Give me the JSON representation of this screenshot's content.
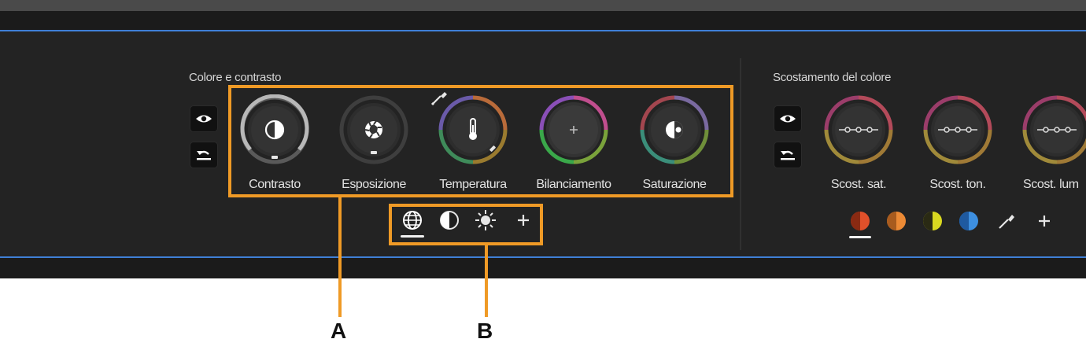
{
  "colors": {
    "accent": "#3f7fd6",
    "highlight": "#ef9a26",
    "panel_bg": "#232323"
  },
  "left_section": {
    "title": "Colore e contrasto",
    "visibility_icon": "eye-icon",
    "reset_icon": "reset-icon",
    "knobs": [
      {
        "label": "Contrasto",
        "icon": "contrast-icon"
      },
      {
        "label": "Esposizione",
        "icon": "aperture-icon"
      },
      {
        "label": "Temperatura",
        "icon": "thermometer-icon"
      },
      {
        "label": "Bilanciamento",
        "icon": "plus-icon"
      },
      {
        "label": "Saturazione",
        "icon": "saturation-icon"
      }
    ],
    "modes": [
      {
        "icon": "globe-icon",
        "active": true
      },
      {
        "icon": "half-circle-icon",
        "active": false
      },
      {
        "icon": "sun-icon",
        "active": false
      },
      {
        "icon": "plus-icon",
        "active": false
      }
    ]
  },
  "right_section": {
    "title": "Scostamento del colore",
    "visibility_icon": "eye-icon",
    "reset_icon": "reset-icon",
    "knobs": [
      {
        "label": "Scost. sat."
      },
      {
        "label": "Scost. ton."
      },
      {
        "label": "Scost. lum"
      }
    ],
    "swatches": [
      {
        "icon": "red-swatch",
        "color": "#e0502a",
        "active": true
      },
      {
        "icon": "orange-swatch",
        "color": "#ec8a35",
        "active": false
      },
      {
        "icon": "yellow-swatch",
        "color": "#d9d820",
        "active": false
      },
      {
        "icon": "blue-swatch",
        "color": "#3d8fe0",
        "active": false
      }
    ],
    "eyedropper_icon": "eyedropper-icon",
    "add_icon": "plus-icon"
  },
  "callouts": {
    "a": "A",
    "b": "B"
  }
}
